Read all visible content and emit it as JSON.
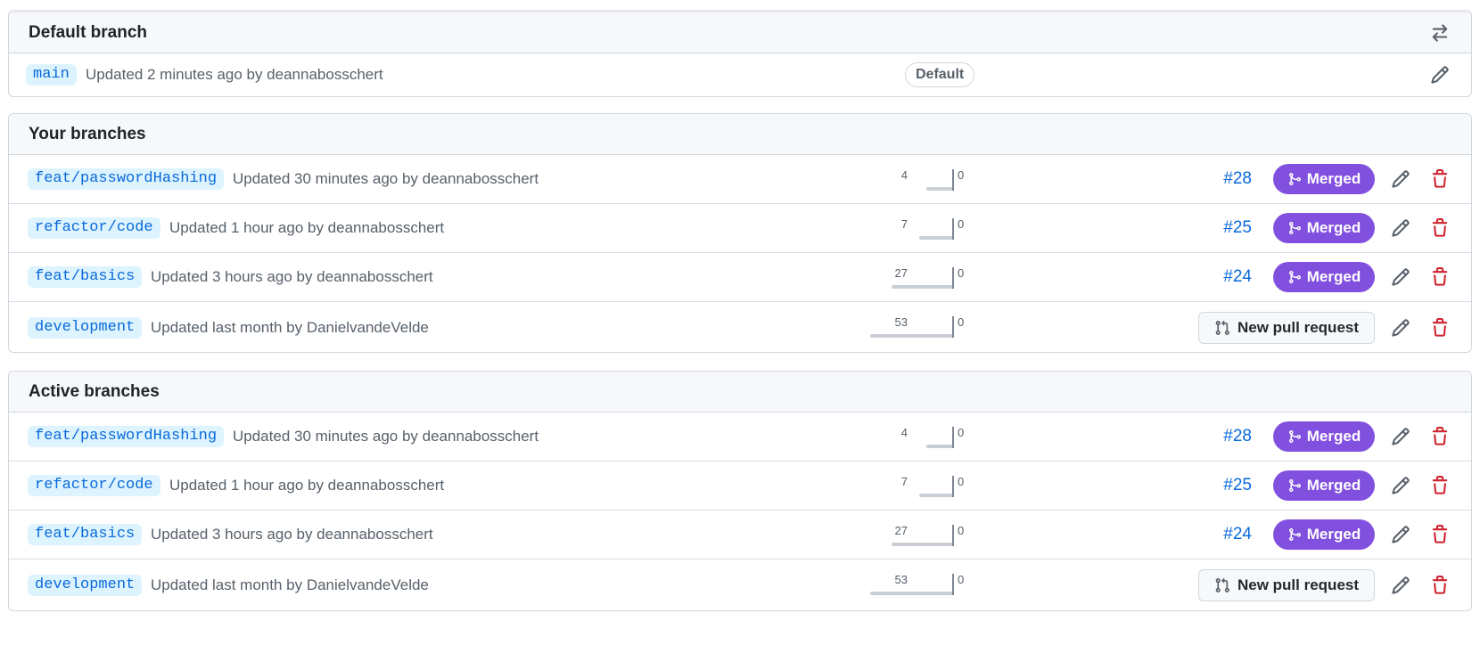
{
  "sections": {
    "default": {
      "title": "Default branch",
      "branch": "main",
      "desc": "Updated 2 minutes ago by deannabosschert",
      "badge": "Default"
    },
    "yours": {
      "title": "Your branches",
      "rows": [
        {
          "branch": "feat/passwordHashing",
          "desc": "Updated 30 minutes ago by deannabosschert",
          "behind": "4",
          "ahead": "0",
          "pr": "#28",
          "status": "Merged"
        },
        {
          "branch": "refactor/code",
          "desc": "Updated 1 hour ago by deannabosschert",
          "behind": "7",
          "ahead": "0",
          "pr": "#25",
          "status": "Merged"
        },
        {
          "branch": "feat/basics",
          "desc": "Updated 3 hours ago by deannabosschert",
          "behind": "27",
          "ahead": "0",
          "pr": "#24",
          "status": "Merged"
        },
        {
          "branch": "development",
          "desc": "Updated last month by DanielvandeVelde",
          "behind": "53",
          "ahead": "0",
          "action": "New pull request"
        }
      ]
    },
    "active": {
      "title": "Active branches",
      "rows": [
        {
          "branch": "feat/passwordHashing",
          "desc": "Updated 30 minutes ago by deannabosschert",
          "behind": "4",
          "ahead": "0",
          "pr": "#28",
          "status": "Merged"
        },
        {
          "branch": "refactor/code",
          "desc": "Updated 1 hour ago by deannabosschert",
          "behind": "7",
          "ahead": "0",
          "pr": "#25",
          "status": "Merged"
        },
        {
          "branch": "feat/basics",
          "desc": "Updated 3 hours ago by deannabosschert",
          "behind": "27",
          "ahead": "0",
          "pr": "#24",
          "status": "Merged"
        },
        {
          "branch": "development",
          "desc": "Updated last month by DanielvandeVelde",
          "behind": "53",
          "ahead": "0",
          "action": "New pull request"
        }
      ]
    }
  },
  "icons": {
    "switch": "arrow-switch-icon",
    "edit": "pencil-icon",
    "delete": "trash-icon",
    "merged": "git-merge-icon",
    "new_pr": "git-pull-request-icon"
  },
  "colors": {
    "link": "#0969da",
    "merged": "#8250df",
    "danger": "#cf222e"
  }
}
